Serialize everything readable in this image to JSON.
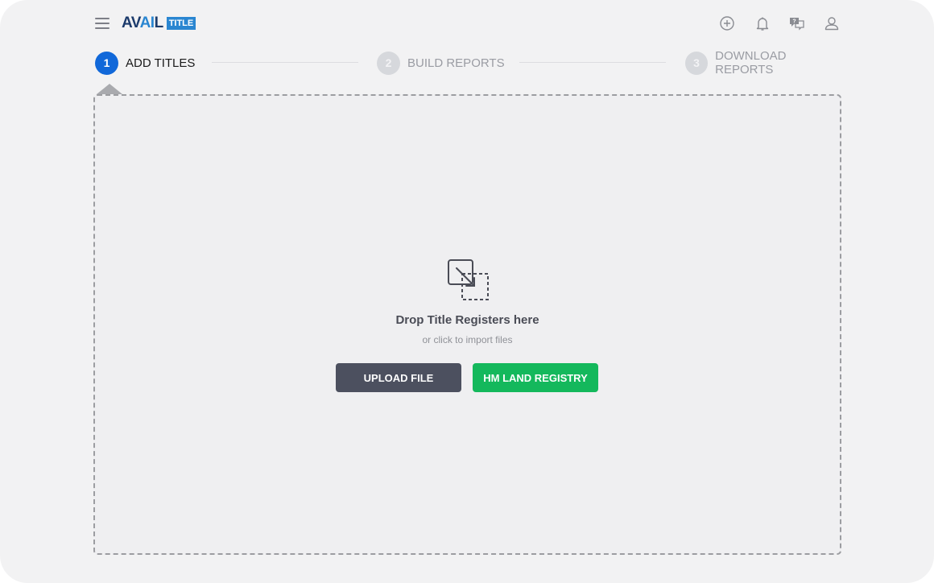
{
  "header": {
    "logo": {
      "part1": "AV",
      "part2": "AI",
      "part3": "L",
      "badge": "TITLE"
    },
    "icons": [
      "plus-circle-icon",
      "bell-icon",
      "help-chat-icon",
      "user-icon"
    ]
  },
  "stepper": {
    "steps": [
      {
        "number": "1",
        "label": "ADD TITLES",
        "state": "active"
      },
      {
        "number": "2",
        "label": "BUILD REPORTS",
        "state": "inactive"
      },
      {
        "number": "3",
        "label": "DOWNLOAD REPORTS",
        "state": "inactive"
      }
    ]
  },
  "dropzone": {
    "title": "Drop Title Registers here",
    "subtitle": "or click to import files",
    "upload_button": "UPLOAD FILE",
    "hm_button": "HM LAND REGISTRY"
  },
  "colors": {
    "accent": "#1168d9",
    "upload_button": "#4c505f",
    "hm_button": "#14b85c",
    "logo_dark": "#1b3a6b",
    "logo_blue": "#2a86d1"
  }
}
